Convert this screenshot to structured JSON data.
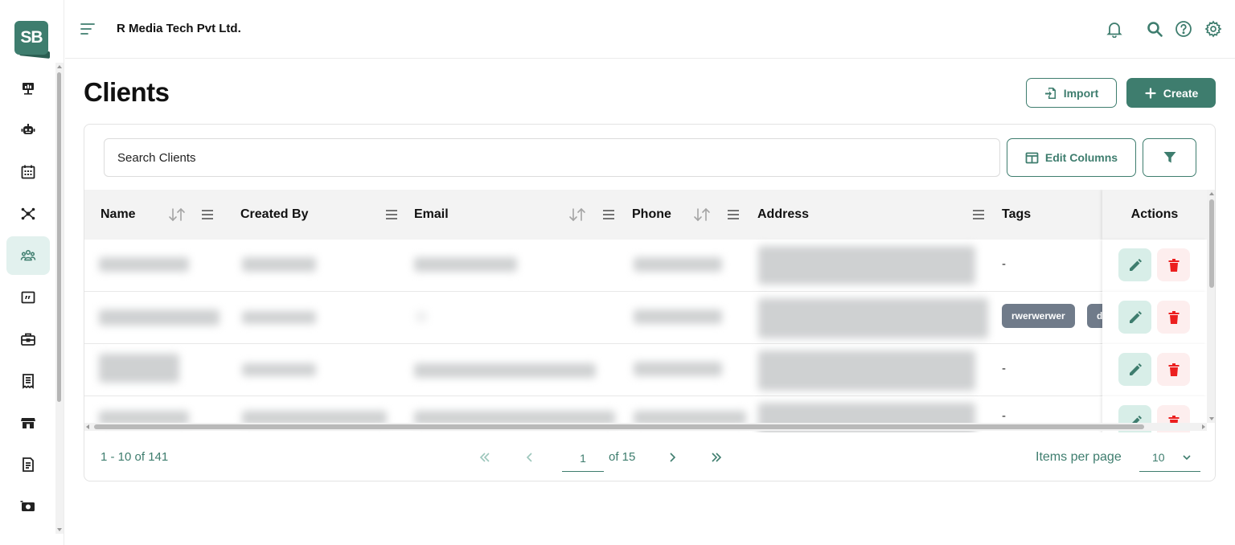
{
  "brand": {
    "logo_text": "SB",
    "color": "#3e7d6e"
  },
  "header": {
    "company_name": "R Media Tech Pvt Ltd."
  },
  "sidebar": {
    "items": [
      {
        "icon": "presentation-board-icon",
        "active": false
      },
      {
        "icon": "robot-icon",
        "active": false
      },
      {
        "icon": "calendar-icon",
        "active": false
      },
      {
        "icon": "team-network-icon",
        "active": false
      },
      {
        "icon": "clients-icon",
        "active": true
      },
      {
        "icon": "quote-icon",
        "active": false
      },
      {
        "icon": "briefcase-icon",
        "active": false
      },
      {
        "icon": "receipt-icon",
        "active": false
      },
      {
        "icon": "store-icon",
        "active": false
      },
      {
        "icon": "document-list-icon",
        "active": false
      },
      {
        "icon": "money-icon",
        "active": false
      }
    ]
  },
  "page": {
    "title": "Clients",
    "import_label": "Import",
    "create_label": "Create"
  },
  "toolbar": {
    "search_placeholder": "Search Clients",
    "edit_columns_label": "Edit Columns"
  },
  "table": {
    "columns": {
      "name": "Name",
      "created_by": "Created By",
      "email": "Email",
      "phone": "Phone",
      "address": "Address",
      "tags": "Tags",
      "actions": "Actions"
    },
    "rows": [
      {
        "tags_text": "-",
        "tags": []
      },
      {
        "tags_text": "",
        "tags": [
          "rwerwerwer",
          "d"
        ]
      },
      {
        "tags_text": "-",
        "tags": []
      },
      {
        "tags_text": "-",
        "tags": []
      }
    ]
  },
  "paginator": {
    "range": "1 - 10 of 141",
    "current_page": "1",
    "of_text": "of 15",
    "items_per_page_label": "Items per page",
    "items_per_page_value": "10"
  }
}
